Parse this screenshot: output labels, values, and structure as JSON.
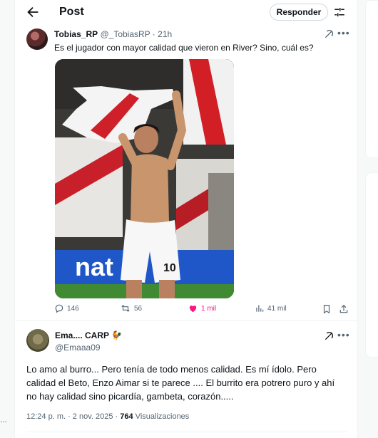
{
  "header": {
    "title": "Post",
    "reply_button": "Responder"
  },
  "tweet": {
    "author_name": "Tobias_RP",
    "author_handle": "@_TobiasRP",
    "separator": " · ",
    "time": "21h",
    "text": "Es el jugador con mayor calidad que vieron en River? Sino, cuál es?",
    "image_jersey_number": "10",
    "image_banner_text": "nat",
    "stats": {
      "replies": "146",
      "reposts": "56",
      "likes": "1 mil",
      "views": "41 mil"
    },
    "like_color": "#f91880"
  },
  "reply": {
    "author_name": "Ema.... CARP",
    "author_handle": "@Emaaa09",
    "text": "Lo amo al burro... Pero tenía de todo menos calidad. Es mí ídolo. Pero calidad el Beto, Enzo Aimar si te parece .... El burrito era potrero puro y ahí no hay calidad sino picardía, gambeta, corazón.....",
    "timestamp": "12:24 p. m. · 2 nov. 2025 · ",
    "views_count": "764",
    "views_label": " Visualizaciones"
  },
  "side": {
    "left_dots": "..."
  },
  "colors": {
    "text": "#0f1419",
    "secondary": "#536471",
    "border": "#eff3f4"
  }
}
